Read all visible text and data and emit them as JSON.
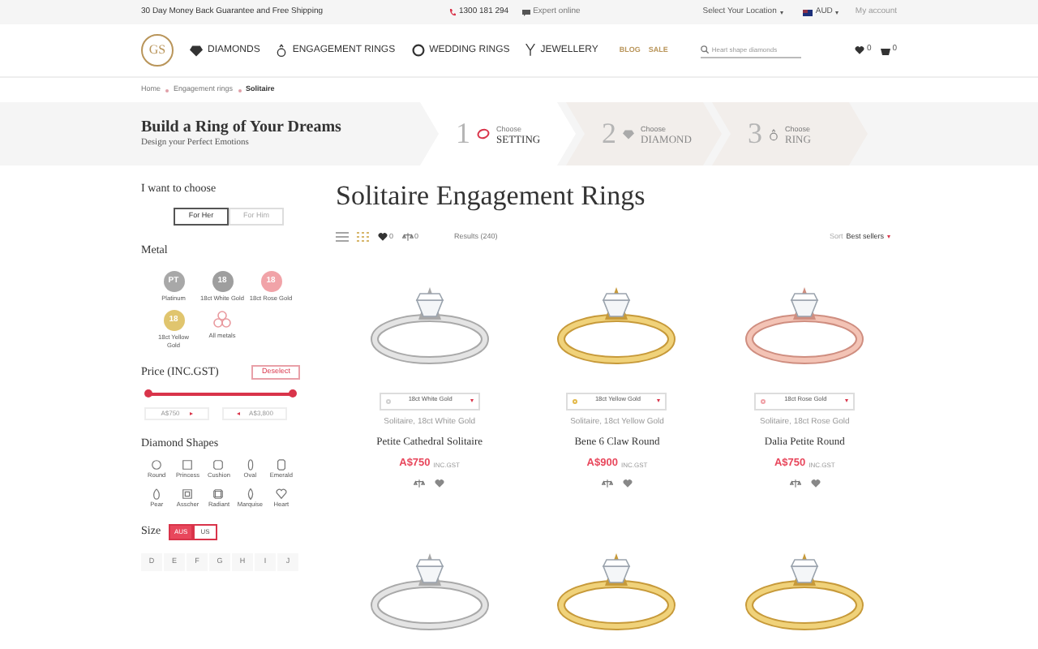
{
  "top_bar": {
    "promo": "30 Day Money Back Guarantee and Free Shipping",
    "phone": "1300 181 294",
    "expert": "Expert online",
    "location": "Select Your Location",
    "currency": "AUD",
    "account": "My account"
  },
  "nav": {
    "logo": "GS",
    "items": [
      "DIAMONDS",
      "ENGAGEMENT RINGS",
      "WEDDING RINGS",
      "JEWELLERY"
    ],
    "links": [
      "BLOG",
      "SALE"
    ],
    "search_placeholder": "Heart shape diamonds",
    "wishlist_count": "0",
    "cart_count": "0"
  },
  "breadcrumb": [
    {
      "label": "Home",
      "current": false
    },
    {
      "label": "Engagement rings",
      "current": false
    },
    {
      "label": "Solitaire",
      "current": true
    }
  ],
  "banner": {
    "title": "Build a Ring of Your Dreams",
    "subtitle": "Design your Perfect Emotions",
    "steps": [
      {
        "number": "1",
        "caption": "Choose",
        "label": "SETTING",
        "selected": true
      },
      {
        "number": "2",
        "caption": "Choose",
        "label": "DIAMOND",
        "selected": false
      },
      {
        "number": "3",
        "caption": "Choose",
        "label": "RING",
        "selected": false
      }
    ]
  },
  "filters": {
    "choose_heading": "I want to choose",
    "gender": [
      {
        "label": "For Her",
        "selected": true
      },
      {
        "label": "For Him",
        "selected": false
      }
    ],
    "metal_heading": "Metal",
    "metals": [
      {
        "kind": "swatch",
        "badge": "PT",
        "label": "Platinum",
        "color": "#a8a8a8"
      },
      {
        "kind": "swatch",
        "badge": "18",
        "label": "18ct White Gold",
        "color": "#9e9e9e"
      },
      {
        "kind": "swatch",
        "badge": "18",
        "label": "18ct Rose Gold",
        "color": "#f1a3a8"
      },
      {
        "kind": "swatch",
        "badge": "18",
        "label": "18ct Yellow Gold",
        "color": "#e0c56e"
      },
      {
        "kind": "all",
        "label": "All metals"
      }
    ],
    "price_heading": "Price (INC.GST)",
    "deselect": "Deselect",
    "price_slider": {
      "level": 1
    },
    "price_min": "A$750",
    "price_max": "A$3,800",
    "shapes_heading": "Diamond Shapes",
    "shapes": [
      "Round",
      "Princess",
      "Cushion",
      "Oval",
      "Emerald",
      "Pear",
      "Asscher",
      "Radiant",
      "Marquise",
      "Heart"
    ],
    "size_heading": "Size",
    "size_systems": [
      {
        "label": "AUS",
        "selected": true
      },
      {
        "label": "US",
        "selected": false
      }
    ],
    "size_letters": [
      "D",
      "E",
      "F",
      "G",
      "H",
      "I",
      "J"
    ]
  },
  "main": {
    "title": "Solitaire Engagement Rings",
    "views": [
      {
        "kind": "list",
        "selected": false
      },
      {
        "kind": "grid",
        "selected": true
      }
    ],
    "wishlist_count": "0",
    "compare_count": "0",
    "results": "Results (240)",
    "sort_label": "Sort",
    "sort_value": "Best sellers",
    "products": [
      {
        "kind": "white",
        "metal_option": "18ct White Gold",
        "color": "#d0d0d0",
        "subtitle": "Solitaire, 18ct White Gold",
        "name": "Petite Cathedral Solitaire",
        "price": "A$750",
        "tax_note": "INC.GST"
      },
      {
        "kind": "yellow",
        "metal_option": "18ct Yellow Gold",
        "color": "#e3b94a",
        "subtitle": "Solitaire, 18ct Yellow Gold",
        "name": "Bene 6 Claw Round",
        "price": "A$900",
        "tax_note": "INC.GST"
      },
      {
        "kind": "rose",
        "metal_option": "18ct Rose Gold",
        "color": "#f0a0a6",
        "subtitle": "Solitaire, 18ct Rose Gold",
        "name": "Dalia Petite Round",
        "price": "A$750",
        "tax_note": "INC.GST"
      }
    ],
    "more_products": [
      {
        "kind": "white"
      },
      {
        "kind": "yellow"
      },
      {
        "kind": "yellow"
      }
    ]
  }
}
